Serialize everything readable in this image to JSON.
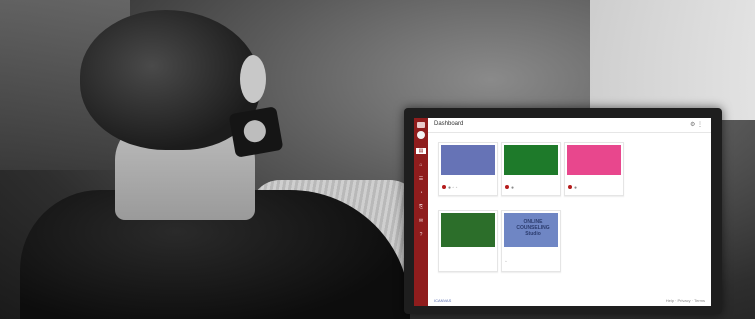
{
  "app": {
    "page_title": "Dashboard",
    "top_icons": "⚙ ⋮",
    "colors": {
      "sidebar": "#8f1d1d",
      "card_blue": "#6673b6",
      "card_green": "#1e7a2a",
      "card_pink": "#e8478d",
      "card_forest": "#2c6e2a",
      "card_lightblue": "#6f86c4",
      "pin": "#b51c1c"
    }
  },
  "sidebar": {
    "items": [
      "▤",
      "⌂",
      "☰",
      "◔",
      "⎘",
      "✉",
      "?"
    ]
  },
  "cards": [
    {
      "name": "card-blue",
      "footer": "● ◦ ◦"
    },
    {
      "name": "card-green",
      "footer": "●"
    },
    {
      "name": "card-pink",
      "footer": "●"
    },
    {
      "name": "card-forest",
      "footer": ""
    },
    {
      "name": "card-online-counseling",
      "text": "ONLINE\nCOUNSELING\nStudio",
      "footer": "◦"
    }
  ],
  "footer": {
    "left": "ICANVAS",
    "right": "Help · Privacy · Terms"
  }
}
